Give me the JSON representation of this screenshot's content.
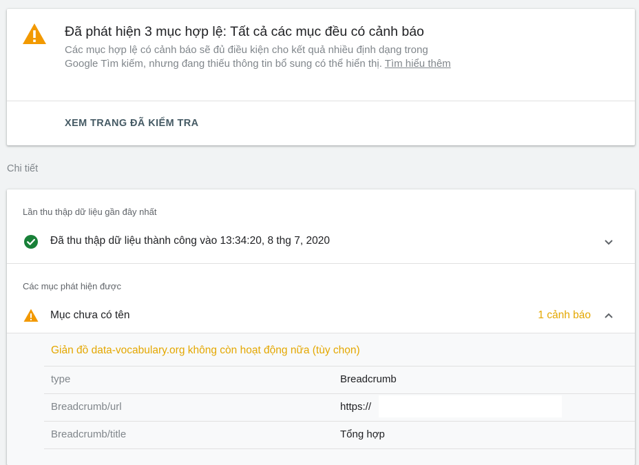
{
  "summary": {
    "title": "Đã phát hiện 3 mục hợp lệ: Tất cả các mục đều có cảnh báo",
    "description": "Các mục hợp lệ có cảnh báo sẽ đủ điều kiện cho kết quả nhiều định dạng trong Google Tìm kiếm, nhưng đang thiếu thông tin bổ sung có thể hiển thị. ",
    "learn_more": "Tìm hiểu thêm",
    "view_page_button": "XEM TRANG ĐÃ KIỂM TRA"
  },
  "details_heading": "Chi tiết",
  "crawl": {
    "label": "Lần thu thập dữ liệu gần đây nhất",
    "status": "Đã thu thập dữ liệu thành công vào 13:34:20, 8 thg 7, 2020"
  },
  "detected": {
    "label": "Các mục phát hiện được",
    "item_name": "Mục chưa có tên",
    "warning_count": "1 cảnh báo",
    "schema_warning": "Giản đồ data-vocabulary.org không còn hoạt động nữa (tùy chọn)",
    "properties": [
      {
        "key": "type",
        "value": "Breadcrumb"
      },
      {
        "key": "Breadcrumb/url",
        "value": "https://"
      },
      {
        "key": "Breadcrumb/title",
        "value": "Tổng hợp"
      }
    ]
  },
  "colors": {
    "warning": "#f29900",
    "warning_text": "#e4a700",
    "success": "#188038"
  },
  "icons": [
    "warning-icon",
    "check-circle-icon",
    "chevron-down-icon",
    "chevron-up-icon"
  ]
}
